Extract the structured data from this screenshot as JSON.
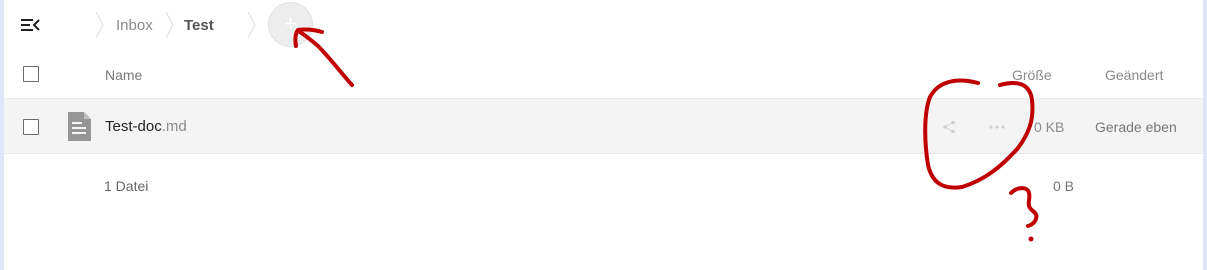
{
  "breadcrumb": {
    "items": [
      {
        "label": "Inbox"
      },
      {
        "label": "Test"
      }
    ]
  },
  "add_button": {
    "symbol": "+"
  },
  "table": {
    "headers": {
      "name": "Name",
      "size": "Größe",
      "modified": "Geändert"
    },
    "rows": [
      {
        "name_base": "Test-doc",
        "name_ext": ".md",
        "size": "0 KB",
        "modified": "Gerade eben"
      }
    ],
    "summary": {
      "count": "1 Datei",
      "size": "0 B"
    }
  },
  "icons": {
    "menu": "menu-collapse-icon",
    "file": "text-file-icon",
    "share": "share-icon",
    "more": "more-icon"
  },
  "annotations": {
    "color": "#c00000",
    "question_mark": "?"
  },
  "colors": {
    "row_hover": "#f4f4f4",
    "side_strip": "#dfe7f7",
    "icon_gray": "#969696"
  }
}
